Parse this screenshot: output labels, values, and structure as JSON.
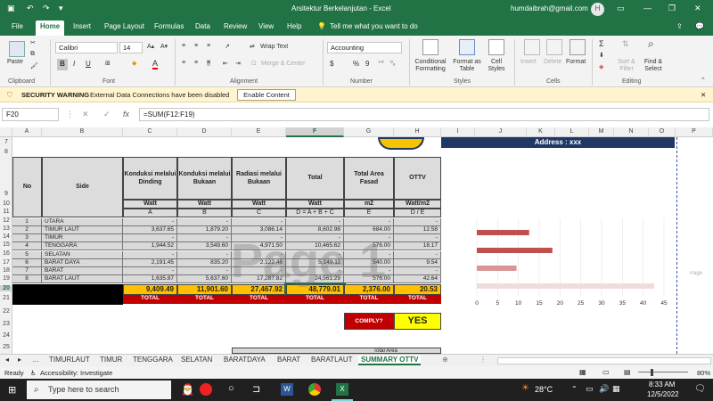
{
  "window": {
    "title": "Arsitektur Berkelanjutan  -  Excel",
    "user": "humdaibrah@gmail.com",
    "avatar": "H"
  },
  "menu": {
    "tabs": [
      "File",
      "Home",
      "Insert",
      "Page Layout",
      "Formulas",
      "Data",
      "Review",
      "View",
      "Help"
    ],
    "active": "Home",
    "tell_me": "Tell me what you want to do"
  },
  "ribbon": {
    "clipboard": {
      "label": "Clipboard",
      "paste": "Paste"
    },
    "font": {
      "label": "Font",
      "name": "Calibri",
      "size": "14",
      "bold": "B",
      "italic": "I",
      "underline": "U"
    },
    "alignment": {
      "label": "Alignment",
      "wrap": "Wrap Text",
      "merge": "Merge & Center"
    },
    "number": {
      "label": "Number",
      "format": "Accounting",
      "currency": "$",
      "percent": "%",
      "comma": "9"
    },
    "styles": {
      "label": "Styles",
      "conditional": "Conditional Formatting",
      "format_table": "Format as Table",
      "cell_styles": "Cell Styles"
    },
    "cells": {
      "label": "Cells",
      "insert": "Insert",
      "delete": "Delete",
      "format": "Format"
    },
    "editing": {
      "label": "Editing",
      "sort": "Sort & Filter",
      "find": "Find & Select"
    }
  },
  "security": {
    "label": "SECURITY WARNING",
    "message": "External Data Connections have been disabled",
    "button": "Enable Content"
  },
  "formula_bar": {
    "name_box": "F20",
    "formula": "=SUM(F12:F19)",
    "fx": "fx"
  },
  "columns": [
    "A",
    "B",
    "C",
    "D",
    "E",
    "F",
    "G",
    "H",
    "I",
    "J",
    "K",
    "L",
    "M",
    "N",
    "O",
    "P"
  ],
  "rows": [
    "7",
    "8",
    "9",
    "10",
    "11",
    "12",
    "13",
    "14",
    "15",
    "16",
    "17",
    "18",
    "19",
    "20",
    "21",
    "22",
    "23",
    "24",
    "25"
  ],
  "address": "Address : xxx",
  "table": {
    "headers": [
      "No",
      "Side",
      "Konduksi melalui Dinding",
      "Konduksi melalui Bukaan",
      "Radiasi melalui Bukaan",
      "Total",
      "Total Area Fasad",
      "OTTV"
    ],
    "units": [
      "Watt",
      "Watt",
      "Watt",
      "Watt",
      "m2",
      "Watt/m2"
    ],
    "formula_row": [
      "A",
      "B",
      "C",
      "D = A + B + C",
      "E",
      "D / E"
    ],
    "rows": [
      {
        "no": "1",
        "side": "UTARA",
        "c": "-",
        "d": "-",
        "e": "-",
        "f": "-",
        "g": "-",
        "h": "-"
      },
      {
        "no": "2",
        "side": "TIMUR LAUT",
        "c": "3,637.65",
        "d": "1,879.20",
        "e": "3,086.14",
        "f": "8,602.98",
        "g": "684.00",
        "h": "12.58"
      },
      {
        "no": "3",
        "side": "TIMUR",
        "c": "-",
        "d": "-",
        "e": "-",
        "f": "-",
        "g": "-",
        "h": "-"
      },
      {
        "no": "4",
        "side": "TENGGARA",
        "c": "1,944.52",
        "d": "3,549.60",
        "e": "4,971.50",
        "f": "10,465.62",
        "g": "576.00",
        "h": "18.17"
      },
      {
        "no": "5",
        "side": "SELATAN",
        "c": "-",
        "d": "-",
        "e": "-",
        "f": "-",
        "g": "-",
        "h": "-"
      },
      {
        "no": "6",
        "side": "BARAT DAYA",
        "c": "2,191.45",
        "d": "835.20",
        "e": "2,122.46",
        "f": "5,149.11",
        "g": "540.00",
        "h": "9.54"
      },
      {
        "no": "7",
        "side": "BARAT",
        "c": "-",
        "d": "-",
        "e": "-",
        "f": "-",
        "g": "-",
        "h": "-"
      },
      {
        "no": "8",
        "side": "BARAT LAUT",
        "c": "1,635.87",
        "d": "5,637.60",
        "e": "17,287.82",
        "f": "24,561.29",
        "g": "576.00",
        "h": "42.64"
      }
    ],
    "totals": [
      "9,409.49",
      "11,901.60",
      "27,467.92",
      "48,779.01",
      "2,376.00",
      "20.53"
    ],
    "total_label": "TOTAL",
    "comply_label": "COMPLY?",
    "comply_value": "YES",
    "partial_header": "Total Area"
  },
  "watermark": "Page 1",
  "side_label": "Page",
  "chart_data": {
    "type": "bar",
    "orientation": "horizontal",
    "values": [
      12.58,
      18.17,
      9.54,
      42.64
    ],
    "x_ticks": [
      "0",
      "5",
      "10",
      "15",
      "20",
      "25",
      "30",
      "35",
      "40",
      "45"
    ],
    "xlim": [
      0,
      45
    ],
    "colors": [
      "#c0504d",
      "#c0504d",
      "#d99694",
      "#f2dcdb"
    ]
  },
  "sheets": [
    "TIMURLAUT",
    "TIMUR",
    "TENGGARA",
    "SELATAN",
    "BARATDAYA",
    "BARAT",
    "BARATLAUT",
    "SUMMARY OTTV"
  ],
  "active_sheet": "SUMMARY OTTV",
  "status": {
    "ready": "Ready",
    "accessibility": "Accessibility: Investigate",
    "zoom": "80%"
  },
  "taskbar": {
    "search": "Type here to search",
    "temp": "28°C",
    "time": "8:33 AM",
    "date": "12/5/2022"
  }
}
